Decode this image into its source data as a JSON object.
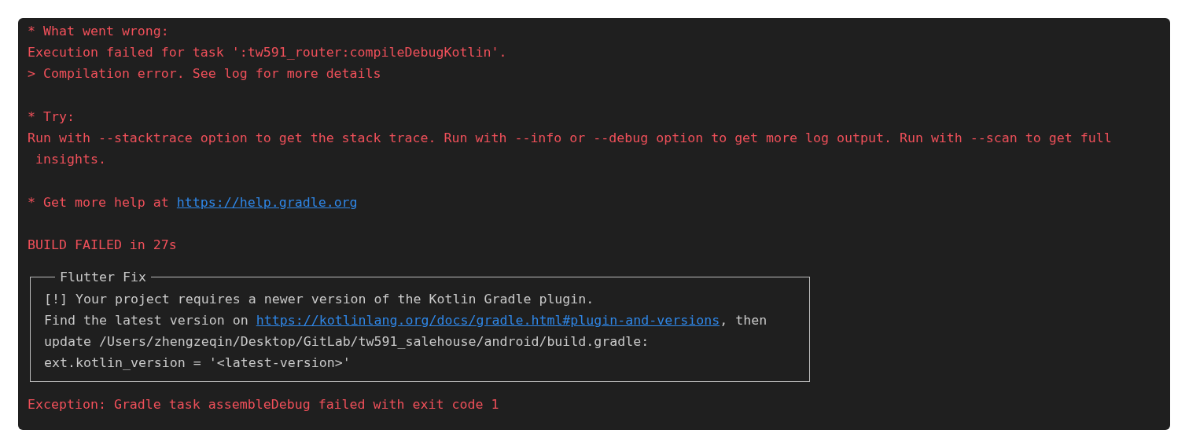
{
  "terminal": {
    "blocks": [
      {
        "lines": [
          {
            "kind": "text",
            "text": "* What went wrong:"
          },
          {
            "kind": "text",
            "text": "Execution failed for task ':tw591_router:compileDebugKotlin'."
          },
          {
            "kind": "text",
            "text": "> Compilation error. See log for more details"
          }
        ]
      },
      {
        "lines": [
          {
            "kind": "text",
            "text": "* Try:"
          },
          {
            "kind": "text",
            "text": "Run with --stacktrace option to get the stack trace. Run with --info or --debug option to get more log output. Run with --scan to get full\n insights."
          }
        ]
      },
      {
        "lines": [
          {
            "kind": "link",
            "text": "* Get more help at ",
            "link": "https://help.gradle.org"
          }
        ]
      },
      {
        "lines": [
          {
            "kind": "text",
            "text": "BUILD FAILED in 27s"
          }
        ]
      },
      {
        "kind": "box",
        "title": "Flutter Fix",
        "lines": [
          {
            "kind": "text",
            "text": "[!] Your project requires a newer version of the Kotlin Gradle plugin."
          },
          {
            "kind": "link",
            "text": "Find the latest version on ",
            "link": "https://kotlinlang.org/docs/gradle.html#plugin-and-versions",
            "after": ", then"
          },
          {
            "kind": "text",
            "text": "update /Users/zhengzeqin/Desktop/GitLab/tw591_salehouse/android/build.gradle:"
          },
          {
            "kind": "text",
            "text": "ext.kotlin_version = '<latest-version>'"
          }
        ]
      },
      {
        "lines": [
          {
            "kind": "text",
            "text": "Exception: Gradle task assembleDebug failed with exit code 1"
          }
        ]
      }
    ]
  }
}
